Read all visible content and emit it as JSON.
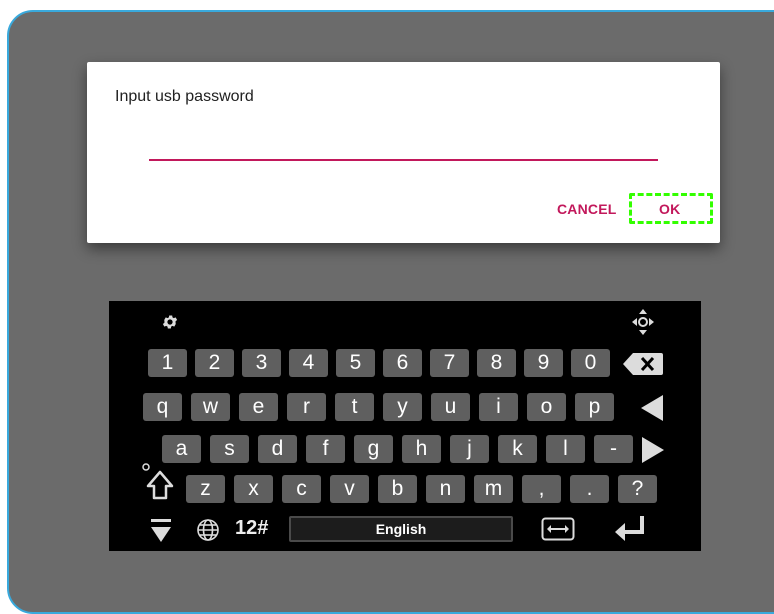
{
  "dialog": {
    "title": "Input usb password",
    "cancel_label": "CANCEL",
    "ok_label": "OK"
  },
  "keyboard": {
    "row1": [
      "1",
      "2",
      "3",
      "4",
      "5",
      "6",
      "7",
      "8",
      "9",
      "0"
    ],
    "row2": [
      "q",
      "w",
      "e",
      "r",
      "t",
      "y",
      "u",
      "i",
      "o",
      "p"
    ],
    "row3": [
      "a",
      "s",
      "d",
      "f",
      "g",
      "h",
      "j",
      "k",
      "l",
      "-"
    ],
    "row4": [
      "z",
      "x",
      "c",
      "v",
      "b",
      "n",
      "m",
      ",",
      ".",
      "?"
    ],
    "symbols_label": "12#",
    "language_label": "English"
  },
  "colors": {
    "accent": "#c2185b",
    "highlight": "#33ff00",
    "frame_border": "#39a9dc"
  },
  "icons": [
    "gear-icon",
    "move-handle-icon",
    "backspace-icon",
    "arrow-left-icon",
    "arrow-right-icon",
    "shift-icon",
    "hide-keyboard-icon",
    "globe-icon",
    "cursor-mode-icon",
    "enter-icon"
  ]
}
